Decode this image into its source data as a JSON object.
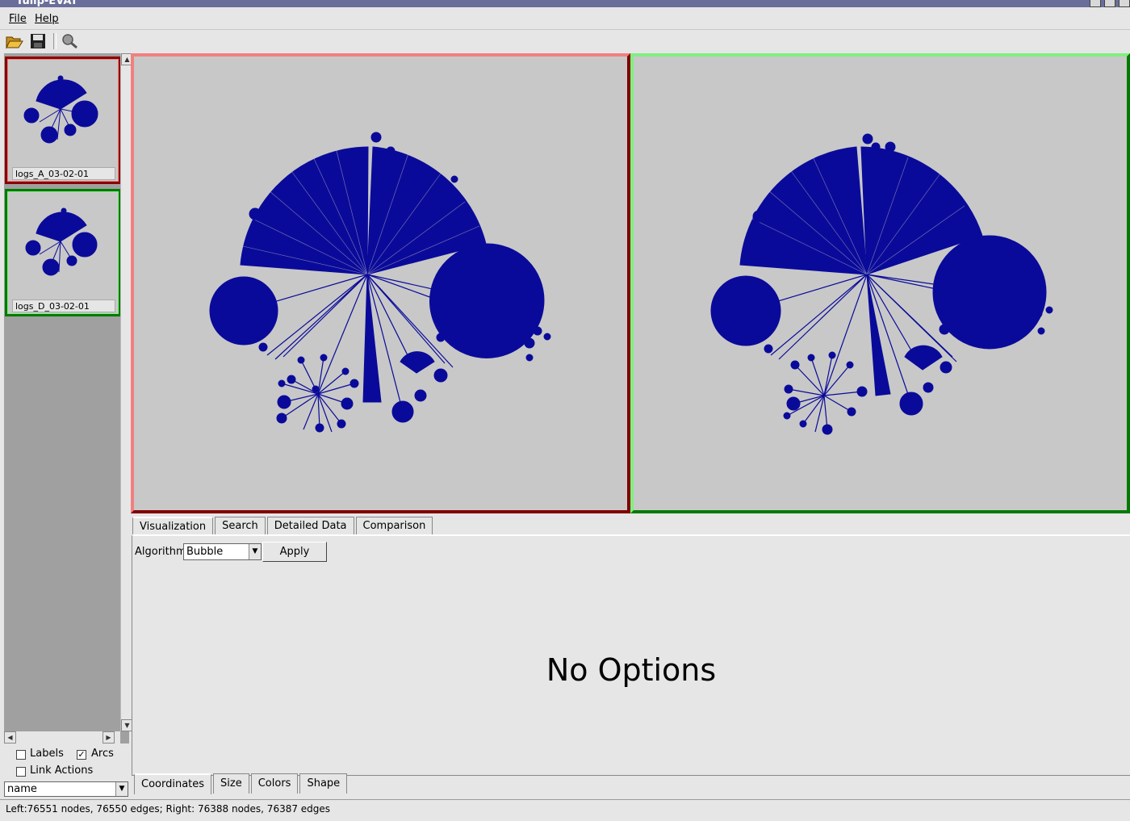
{
  "window": {
    "title": "Tulip-EVAT"
  },
  "menu": {
    "file": "File",
    "help": "Help"
  },
  "toolbar": {
    "open_icon": "open-folder-icon",
    "save_icon": "floppy-save-icon",
    "zoom_icon": "magnifier-icon"
  },
  "thumbnails": [
    {
      "label": "logs_A_03-02-01",
      "frame_color": "#8b0000"
    },
    {
      "label": "logs_D_03-02-01",
      "frame_color": "#007a00"
    }
  ],
  "left_controls": {
    "labels": {
      "label": "Labels",
      "checked": false
    },
    "arcs": {
      "label": "Arcs",
      "checked": true
    },
    "link_actions": {
      "label": "Link Actions",
      "checked": false
    },
    "property_select": "name",
    "checkmark": "✓"
  },
  "views": {
    "left_frame": "#800000",
    "right_frame": "#007a00",
    "graph_color": "#0a0a9a",
    "background": "#c8c8c8"
  },
  "top_tabs": [
    "Visualization",
    "Search",
    "Detailed Data",
    "Comparison"
  ],
  "top_tab_selected": 0,
  "visualization": {
    "algorithm_label": "Algorithm",
    "algorithm_value": "Bubble",
    "apply_label": "Apply",
    "no_options": "No Options"
  },
  "bottom_tabs": [
    "Coordinates",
    "Size",
    "Colors",
    "Shape"
  ],
  "bottom_tab_selected": 0,
  "status": "Left:76551 nodes, 76550 edges; Right: 76388 nodes, 76387 edges"
}
